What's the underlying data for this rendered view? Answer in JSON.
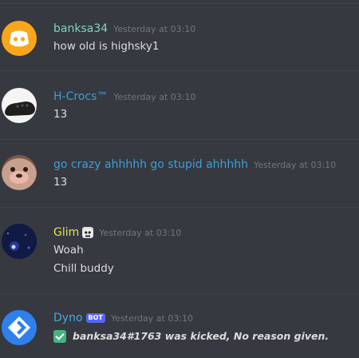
{
  "colors": {
    "background": "#36393f",
    "name_banksa": "#7fd3c5",
    "name_hcrocs": "#3aa0d8",
    "name_gocrazy": "#3aa0d8",
    "name_glim": "#e6e05a",
    "name_dyno": "#4aa6e8",
    "bot_tag": "#5865f2",
    "check": "#43b581"
  },
  "messages": [
    {
      "username": "banksa34",
      "timestamp": "Yesterday at 03:10",
      "lines": [
        "how old is highsky1"
      ],
      "avatar_icon": "discord-logo-icon"
    },
    {
      "username": "H-Crocs™",
      "timestamp": "Yesterday at 03:10",
      "lines": [
        "13"
      ],
      "avatar_icon": "croc-shoe-icon"
    },
    {
      "username": "go crazy ahhhhh go stupid ahhhhh",
      "timestamp": "Yesterday at 03:10",
      "lines": [
        "13"
      ],
      "avatar_icon": "pet-face-icon"
    },
    {
      "username": "Glim",
      "timestamp": "Yesterday at 03:10",
      "lines": [
        "Woah",
        "Chill buddy"
      ],
      "avatar_icon": "galaxy-avatar-icon",
      "badge": "skull-face-icon"
    },
    {
      "username": "Dyno",
      "tag": "BOT",
      "timestamp": "Yesterday at 03:10",
      "lines": [
        "banksa34#1763 was kicked, No reason given."
      ],
      "avatar_icon": "dyno-logo-icon",
      "status_icon": "check-icon"
    }
  ]
}
